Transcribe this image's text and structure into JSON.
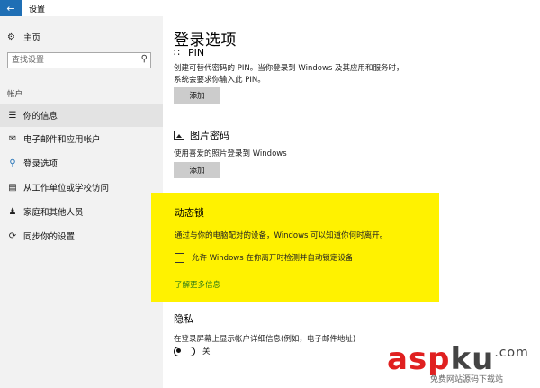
{
  "window": {
    "title": "设置"
  },
  "sidebar": {
    "home_label": "主页",
    "search_placeholder": "查找设置",
    "section_label": "帐户",
    "items": [
      {
        "label": "你的信息",
        "icon": "person-card-icon"
      },
      {
        "label": "电子邮件和应用帐户",
        "icon": "mail-icon"
      },
      {
        "label": "登录选项",
        "icon": "key-icon"
      },
      {
        "label": "从工作单位或学校访问",
        "icon": "briefcase-icon"
      },
      {
        "label": "家庭和其他人员",
        "icon": "person-icon"
      },
      {
        "label": "同步你的设置",
        "icon": "sync-icon"
      }
    ]
  },
  "main": {
    "title": "登录选项",
    "pin": {
      "heading": "PIN",
      "desc_line1": "创建可替代密码的 PIN。当你登录到 Windows 及其应用和服务时，",
      "desc_line2": "系统会要求你输入此 PIN。",
      "button": "添加"
    },
    "picture_password": {
      "heading": "图片密码",
      "desc": "使用喜爱的照片登录到 Windows",
      "button": "添加"
    },
    "dynamic_lock": {
      "heading": "动态锁",
      "desc": "通过与你的电脑配对的设备，Windows 可以知道你何时离开。",
      "checkbox_label": "允许 Windows 在你离开时检测并自动锁定设备",
      "checkbox_checked": false,
      "link": "了解更多信息",
      "highlight_color": "#fff200"
    },
    "privacy": {
      "heading": "隐私",
      "desc": "在登录屏幕上显示帐户详细信息(例如，电子邮件地址)",
      "toggle_label": "关",
      "toggle_on": false
    }
  },
  "watermark": {
    "logo_a": "asp",
    "logo_b": "ku",
    "logo_sup": ".com",
    "sub": "免费网站源码下载站"
  },
  "colors": {
    "accent": "#1f6fb5",
    "link": "#2b7a16",
    "sidebar_bg": "#f2f2f2"
  }
}
